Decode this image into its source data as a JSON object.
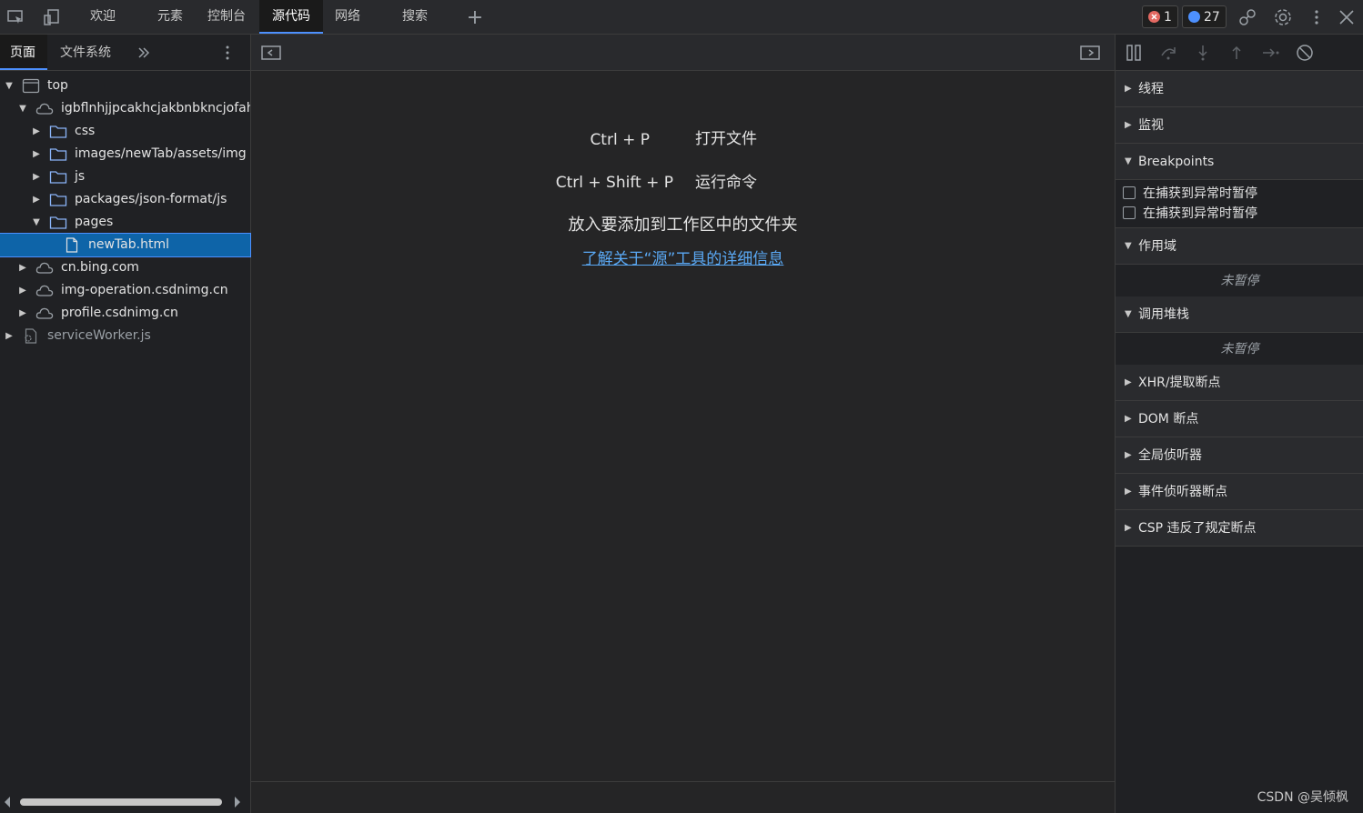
{
  "topbar": {
    "tabs": [
      "欢迎",
      "元素",
      "控制台",
      "源代码",
      "网络",
      "搜索"
    ],
    "active_tab": "源代码",
    "add_tab_label": "+",
    "errors_count": "1",
    "messages_count": "27",
    "error_color": "#e46962",
    "message_color": "#4d90fe"
  },
  "left": {
    "tabs": [
      "页面",
      "文件系统"
    ],
    "active_tab": "页面",
    "tree": [
      {
        "label": "top",
        "indent": 0,
        "state": "open",
        "icon": "frame-icon"
      },
      {
        "label": "igbflnhjjpcakhcjakbnbkncjofahli",
        "indent": 1,
        "state": "open",
        "icon": "cloud-icon"
      },
      {
        "label": "css",
        "indent": 2,
        "state": "closed",
        "icon": "folder-icon"
      },
      {
        "label": "images/newTab/assets/img",
        "indent": 2,
        "state": "closed",
        "icon": "folder-icon"
      },
      {
        "label": "js",
        "indent": 2,
        "state": "closed",
        "icon": "folder-icon"
      },
      {
        "label": "packages/json-format/js",
        "indent": 2,
        "state": "closed",
        "icon": "folder-icon"
      },
      {
        "label": "pages",
        "indent": 2,
        "state": "open",
        "icon": "folder-icon"
      },
      {
        "label": "newTab.html",
        "indent": 3,
        "state": "leaf",
        "icon": "file-icon",
        "selected": true
      },
      {
        "label": "cn.bing.com",
        "indent": 1,
        "state": "closed",
        "icon": "cloud-icon"
      },
      {
        "label": "img-operation.csdnimg.cn",
        "indent": 1,
        "state": "closed",
        "icon": "cloud-icon"
      },
      {
        "label": "profile.csdnimg.cn",
        "indent": 1,
        "state": "closed",
        "icon": "cloud-icon"
      },
      {
        "label": "serviceWorker.js",
        "indent": 0,
        "state": "closed",
        "icon": "gear-file-icon",
        "dim": true
      }
    ]
  },
  "center": {
    "shortcuts": [
      {
        "key": "Ctrl + P",
        "desc": "打开文件"
      },
      {
        "key": "Ctrl + Shift + P",
        "desc": "运行命令"
      }
    ],
    "drop_text": "放入要添加到工作区中的文件夹",
    "learn_link": "了解关于“源”工具的详细信息"
  },
  "right": {
    "sections": {
      "threads": "线程",
      "watch": "监视",
      "breakpoints": "Breakpoints",
      "pause_uncaught": "在捕获到异常时暂停",
      "pause_caught": "在捕获到异常时暂停",
      "scope": "作用域",
      "scope_status": "未暂停",
      "callstack": "调用堆栈",
      "callstack_status": "未暂停",
      "xhr": "XHR/提取断点",
      "dom": "DOM 断点",
      "global": "全局侦听器",
      "event": "事件侦听器断点",
      "csp": "CSP 违反了规定断点"
    }
  },
  "watermark": "CSDN @吴倾枫"
}
